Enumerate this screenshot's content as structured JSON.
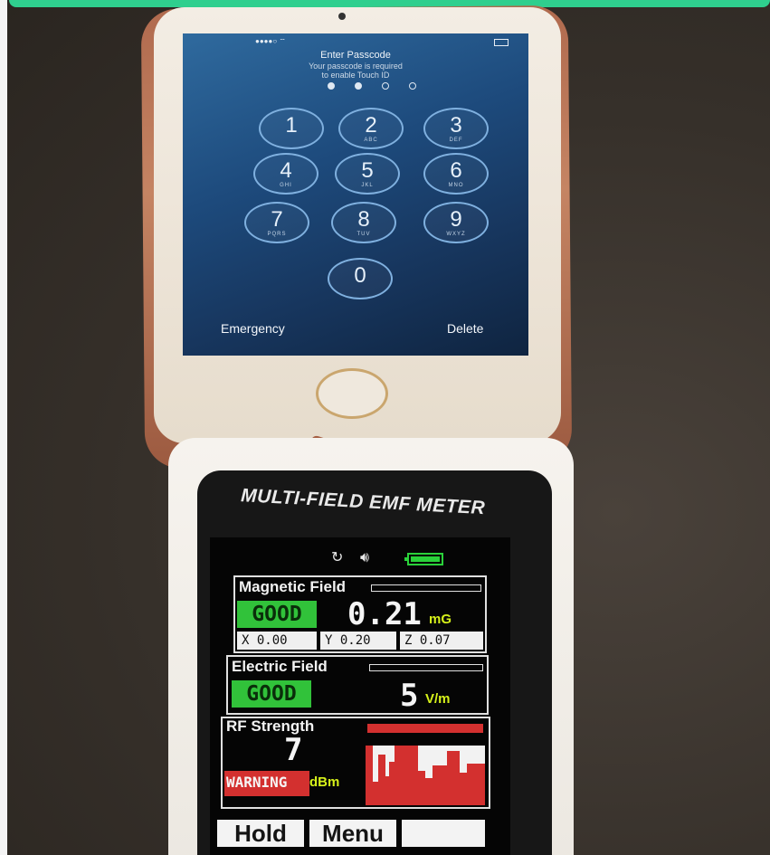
{
  "phone": {
    "screen_title": "Enter Passcode",
    "screen_subtitle_1": "Your passcode is required",
    "screen_subtitle_2": "to enable Touch ID",
    "keys": [
      {
        "num": "1",
        "letters": ""
      },
      {
        "num": "2",
        "letters": "ABC"
      },
      {
        "num": "3",
        "letters": "DEF"
      },
      {
        "num": "4",
        "letters": "GHI"
      },
      {
        "num": "5",
        "letters": "JKL"
      },
      {
        "num": "6",
        "letters": "MNO"
      },
      {
        "num": "7",
        "letters": "PQRS"
      },
      {
        "num": "8",
        "letters": "TUV"
      },
      {
        "num": "9",
        "letters": "WXYZ"
      },
      {
        "num": "0",
        "letters": ""
      }
    ],
    "emergency_label": "Emergency",
    "delete_label": "Delete"
  },
  "meter": {
    "brand": "MULTI-FIELD EMF METER",
    "magnetic": {
      "title": "Magnetic Field",
      "status": "GOOD",
      "value": "0.21",
      "unit": "mG",
      "x": "X  0.00",
      "y": "Y  0.20",
      "z": "Z  0.07"
    },
    "electric": {
      "title": "Electric Field",
      "status": "GOOD",
      "value": "5",
      "unit": "V/m"
    },
    "rf": {
      "title": "RF Strength",
      "value": "7",
      "status": "WARNING",
      "unit": "dBm"
    },
    "softkeys": [
      "Hold",
      "Menu",
      ""
    ]
  },
  "colors": {
    "good": "#31c23a",
    "warning": "#d3302f",
    "unit": "#d6f11a",
    "rf_bar": "#d3302f",
    "topbar": "#2fcf8e"
  },
  "icons": [
    "refresh-icon",
    "speaker-icon",
    "battery-icon"
  ]
}
